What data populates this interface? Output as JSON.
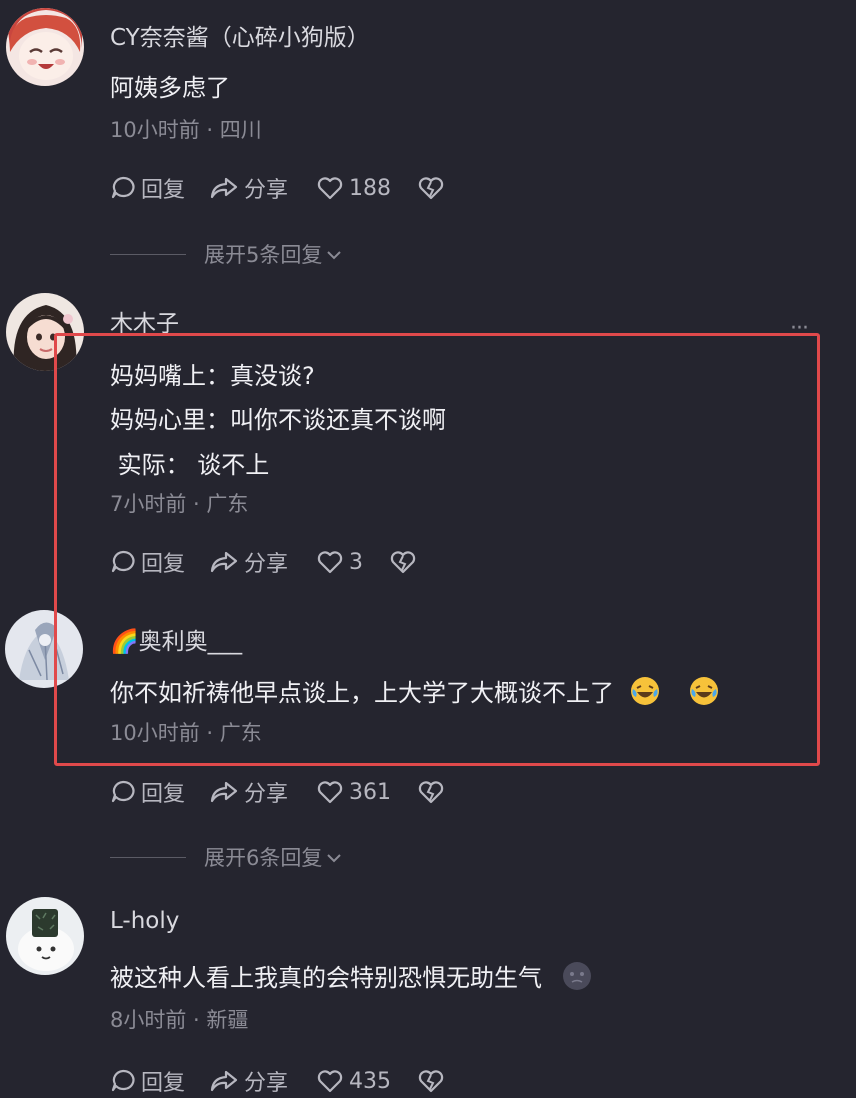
{
  "comments": [
    {
      "username": "CY奈奈酱（心碎小狗版）",
      "text": "阿姨多虑了",
      "meta": "10小时前 · 四川",
      "reply_label": "回复",
      "share_label": "分享",
      "likes": "188",
      "expand_label": "展开5条回复"
    },
    {
      "username": "木木子",
      "lines": [
        "妈妈嘴上：真没谈?",
        "妈妈心里：叫你不谈还真不谈啊",
        " 实际： 谈不上"
      ],
      "meta": "7小时前 · 广东",
      "reply_label": "回复",
      "share_label": "分享",
      "likes": "3",
      "more_label": "···"
    },
    {
      "username": "🌈奥利奥___",
      "text": "你不如祈祷他早点谈上，上大学了大概谈不上了",
      "meta": "10小时前 · 广东",
      "reply_label": "回复",
      "share_label": "分享",
      "likes": "361",
      "expand_label": "展开6条回复"
    },
    {
      "username": "L-holy",
      "text": "被这种人看上我真的会特别恐惧无助生气",
      "meta": "8小时前 · 新疆",
      "reply_label": "回复",
      "share_label": "分享",
      "likes": "435"
    }
  ],
  "colors": {
    "background": "#25252f",
    "highlight": "#e0494b",
    "muted": "#8b8b95"
  }
}
